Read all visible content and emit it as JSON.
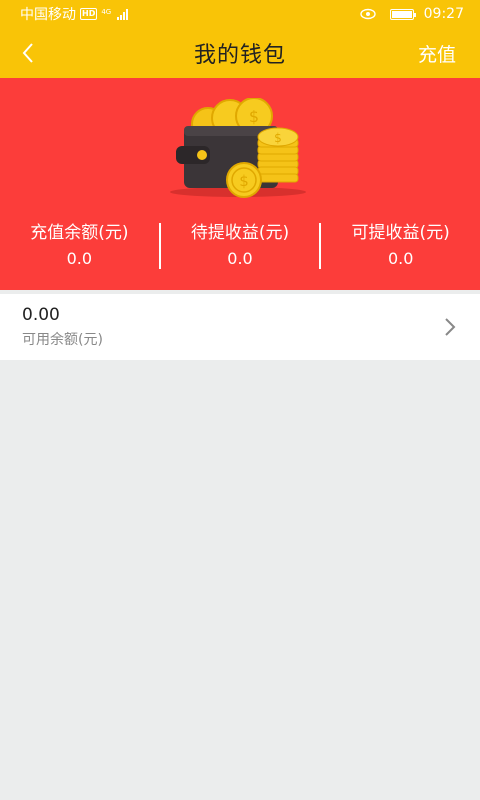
{
  "status_bar": {
    "carrier": "中国移动",
    "network_badge": "HD",
    "network_type": "4G",
    "time": "09:27",
    "battery_level": 1.0,
    "icons": [
      "hd-icon",
      "signal-icon",
      "eye-icon",
      "battery-icon"
    ]
  },
  "nav": {
    "title": "我的钱包",
    "action_label": "充值",
    "back_icon": "chevron-left-icon"
  },
  "colors": {
    "header": "#f9c407",
    "banner": "#fc3d3a",
    "page_bg": "#ebeded"
  },
  "summary": {
    "recharge_balance": {
      "label": "充值余额(元)",
      "value": "0.0"
    },
    "pending_earnings": {
      "label": "待提收益(元)",
      "value": "0.0"
    },
    "withdrawable_earnings": {
      "label": "可提收益(元)",
      "value": "0.0"
    }
  },
  "available": {
    "amount": "0.00",
    "label": "可用余额(元)",
    "arrow_icon": "chevron-right-icon"
  }
}
